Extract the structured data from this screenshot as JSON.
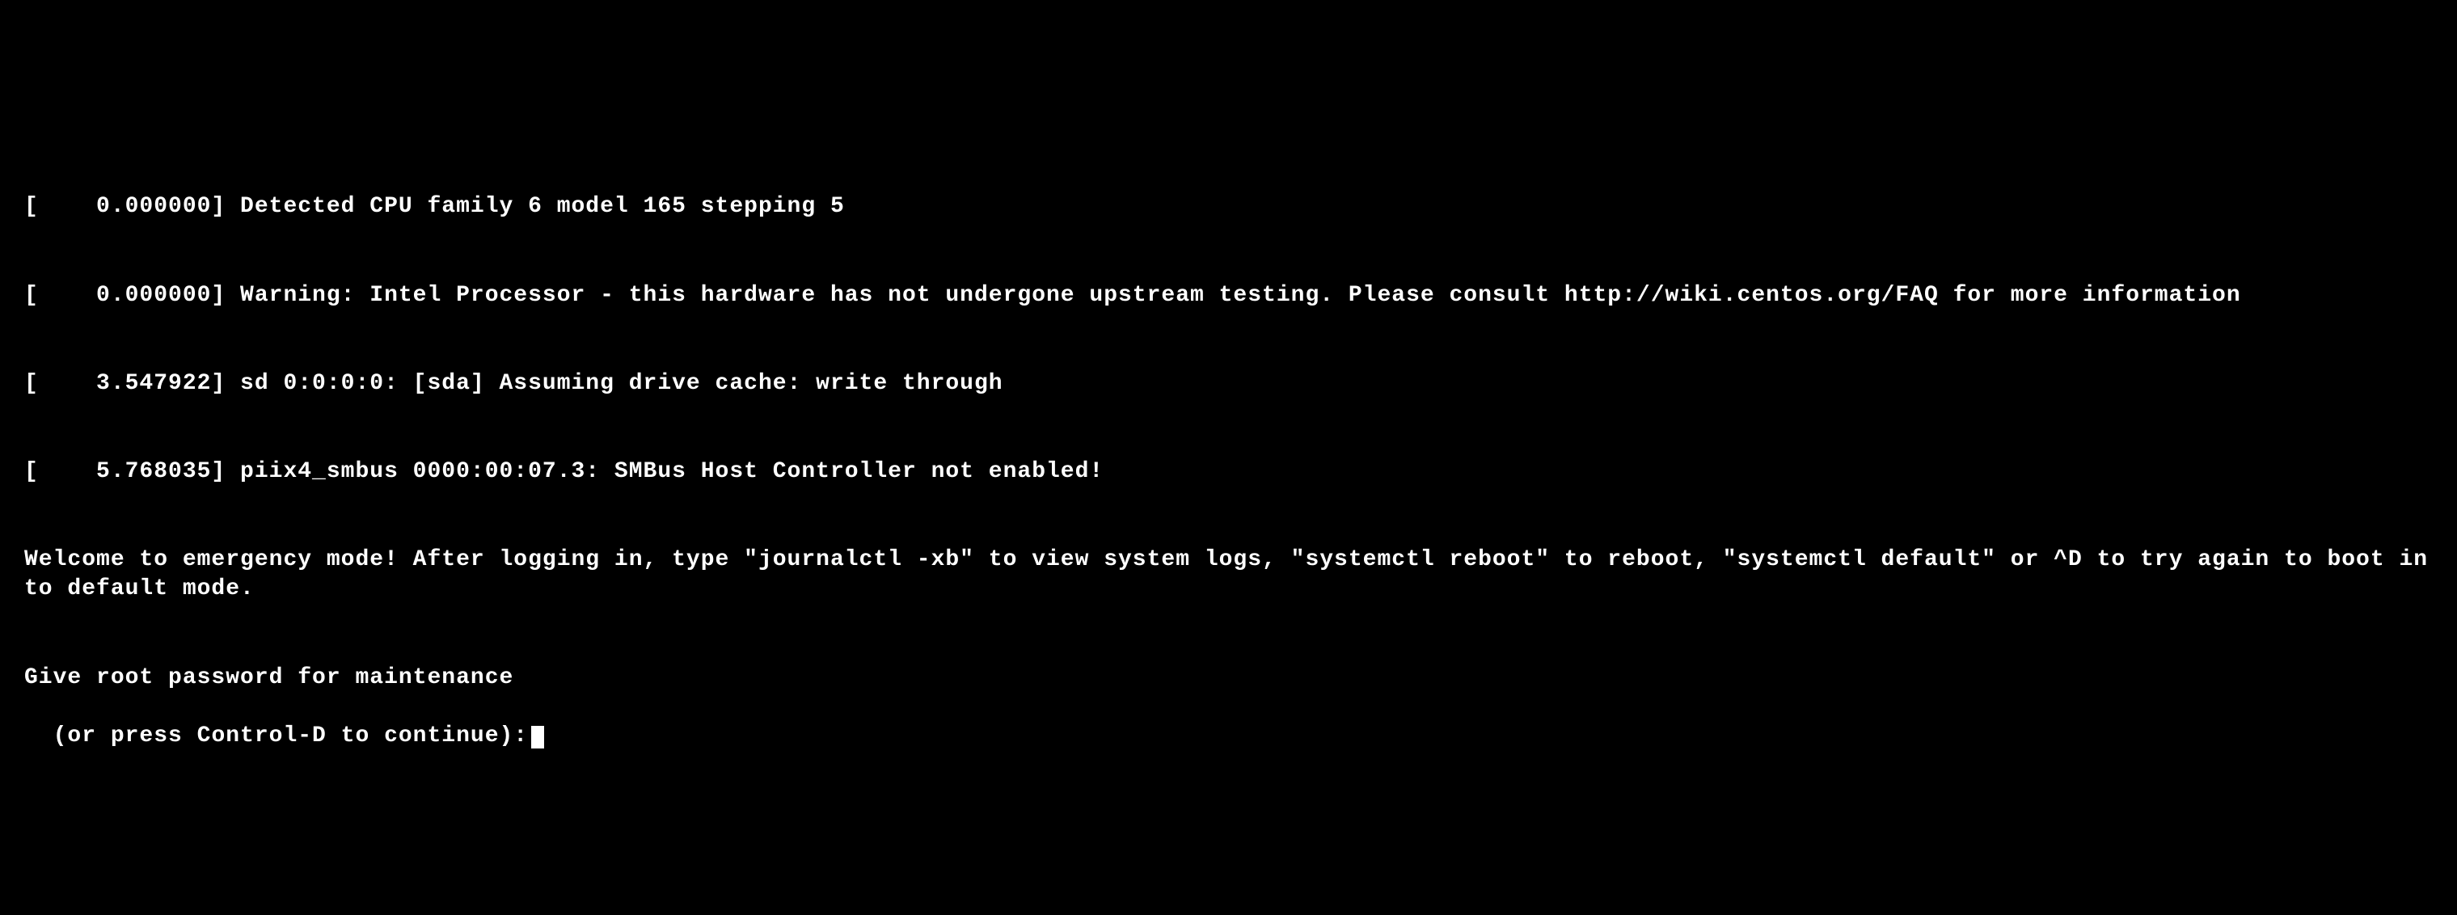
{
  "console": {
    "lines": [
      "[    0.000000] Detected CPU family 6 model 165 stepping 5",
      "[    0.000000] Warning: Intel Processor - this hardware has not undergone upstream testing. Please consult http://wiki.centos.org/FAQ for more information",
      "[    3.547922] sd 0:0:0:0: [sda] Assuming drive cache: write through",
      "[    5.768035] piix4_smbus 0000:00:07.3: SMBus Host Controller not enabled!",
      "Welcome to emergency mode! After logging in, type \"journalctl -xb\" to view system logs, \"systemctl reboot\" to reboot, \"systemctl default\" or ^D to try again to boot into default mode.",
      "Give root password for maintenance",
      "(or press Control-D to continue):"
    ]
  }
}
